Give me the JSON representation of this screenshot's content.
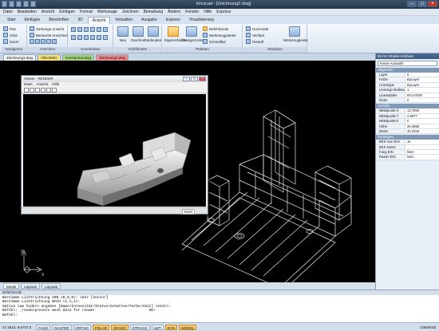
{
  "title": "bricscad  - [Zeichnung2.dwg]",
  "menubar": [
    "Datei",
    "Bearbeiten",
    "Ansicht",
    "Einfügen",
    "Format",
    "Werkzeuge",
    "Zeichnen",
    "Bemaßung",
    "Ändern",
    "Fenster",
    "Hilfe",
    "Express"
  ],
  "ribbon_tabs": [
    "Start",
    "Einfügen",
    "Beschriften",
    "3D",
    "Ansicht",
    "Verwalten",
    "Ausgabe",
    "Express",
    "Visualisierung"
  ],
  "ribbon_active_tab": "Ansicht",
  "ribbon": {
    "navigate": {
      "items": [
        "Pan",
        "Orbit",
        "Zoom"
      ],
      "label": "Navigieren"
    },
    "views": {
      "items": [
        "Vorherige Ansicht",
        "Benannte Ansichten"
      ],
      "label": "Ansichten"
    },
    "coords": {
      "label": "Koordinaten"
    },
    "viewports": {
      "items": [
        "Neu",
        "Zuschnitt",
        "Verbinden"
      ],
      "label": "Schiffenster"
    },
    "palettes": {
      "items": [
        "Eigenschaften",
        "DesignCenter",
        "Befehlszeile",
        "Werkzeugpalette",
        "Schnellkal"
      ],
      "label": "Paletten"
    },
    "windows": {
      "items": [
        "Horizontal",
        "Vertikal",
        "Gestuft",
        "Werkzeugleiste"
      ],
      "label": "Windows"
    }
  },
  "doc_tabs": [
    "Zeichnung1.dwg",
    "Villa.DWG",
    "mechanical.dwg",
    "Zeichnung2.dwg"
  ],
  "model_tabs": [
    "Model",
    "Layout1",
    "Layout2"
  ],
  "viewer": {
    "title": "Viewer - RENDER",
    "menu": [
      "Datei",
      "Ansicht",
      "Hilfe"
    ],
    "status": "NUM"
  },
  "properties": {
    "header": "BCAD Objekt-Attribute",
    "selection": "Keine Auswahl",
    "sections": [
      {
        "name": "Allgemein",
        "rows": [
          [
            "Layer",
            "0"
          ],
          [
            "Farbe",
            "ByLayer"
          ],
          [
            "Linientype",
            "ByLayer"
          ],
          [
            "Linientyp Maßstab",
            "1"
          ],
          [
            "Linienstärke",
            "BYLAYER"
          ],
          [
            "Dicke",
            "0"
          ]
        ]
      },
      {
        "name": "Ansicht",
        "rows": [
          [
            "Mittelpunkt-X",
            "13.7993"
          ],
          [
            "Mittelpunkt-Y",
            "2.8977"
          ],
          [
            "Mittelpunkt-Z",
            "0"
          ],
          [
            "Höhe",
            "25.4658"
          ],
          [
            "Breite",
            "45.2219"
          ]
        ]
      },
      {
        "name": "Sonstiges",
        "rows": [
          [
            "BKS Icon EIN",
            "Ja"
          ],
          [
            "BKS Name",
            ""
          ],
          [
            "Fang EIN",
            "Nein"
          ],
          [
            "Raster EIN",
            "Nein"
          ]
        ]
      }
    ]
  },
  "command": {
    "header": "Befehlszeile",
    "lines": [
      "Bestimme Lichtrichtung VON <0,0,0>: oder [Vector]",
      "Bestimme Lichtrichtung NACH <1,1,1>:",
      "Option zum Ändern angeben [Name/Intensität/Status/Schatten/Farbe/eXit] <eXit>:",
      "Befehl: _renderpresets mesh data for render                         OK!",
      "Befehl:"
    ]
  },
  "status_bar": {
    "coords": "47.4543, 9.6707,0",
    "buttons": [
      "FANG",
      "RASTER",
      "ORTHO",
      "POLAR",
      "OFANG",
      "OTRACK",
      "LWT",
      "DYN",
      "MODEL"
    ],
    "active": [
      "POLAR",
      "OFANG",
      "DYN",
      "MODEL"
    ],
    "right": "Gitterkraft"
  }
}
